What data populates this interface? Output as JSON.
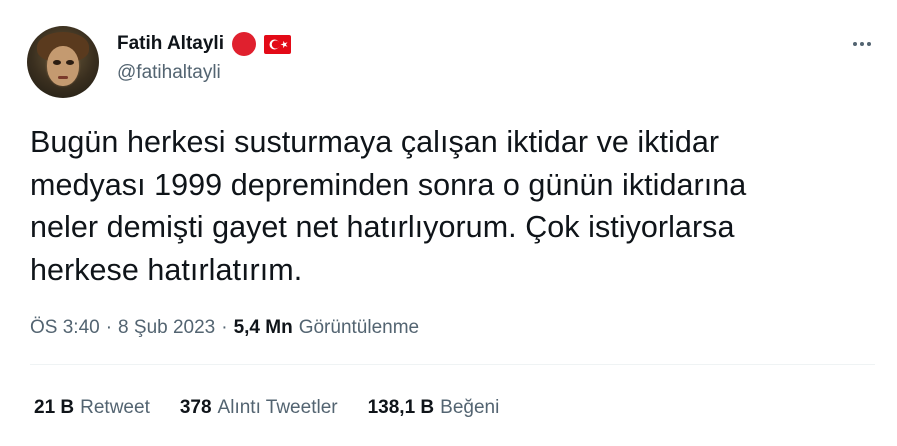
{
  "author": {
    "name": "Fatih Altayli",
    "handle": "@fatihaltayli",
    "badge_color": "#e0202e",
    "flag_icon": "turkey-flag-icon"
  },
  "tweet": {
    "text": "Bugün herkesi susturmaya çalışan iktidar ve iktidar\nmedyası 1999 depreminden sonra o günün iktidarına\nneler demişti gayet net hatırlıyorum. Çok istiyorlarsa\nherkese hatırlatırım."
  },
  "meta": {
    "time": "ÖS 3:40",
    "separator1": "·",
    "date": "8 Şub 2023",
    "separator2": "·",
    "views_count": "5,4 Mn",
    "views_label": "Görüntülenme"
  },
  "stats": [
    {
      "count": "21 B",
      "label": "Retweet"
    },
    {
      "count": "378",
      "label": "Alıntı Tweetler"
    },
    {
      "count": "138,1 B",
      "label": "Beğeni"
    }
  ],
  "colors": {
    "text": "#0f1419",
    "secondary": "#536471",
    "divider": "#eff3f4",
    "flag_red": "#e30a17"
  }
}
